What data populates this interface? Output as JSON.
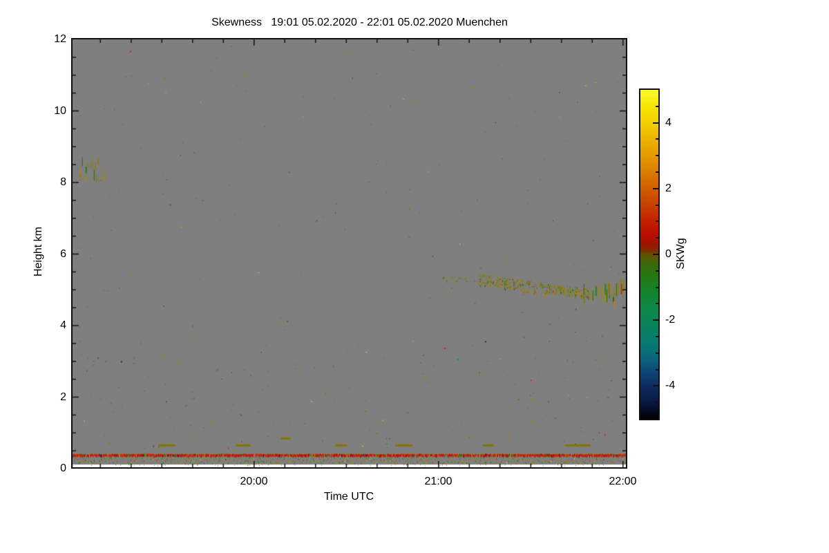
{
  "figure": {
    "title": "Skewness   19:01 05.02.2020 - 22:01 05.02.2020 Muenchen"
  },
  "axes": {
    "x": {
      "label": "Time UTC",
      "range_minutes": [
        0,
        180
      ],
      "start_time": "19:01",
      "end_time": "22:01",
      "major_ticks": [
        {
          "minutes": 59,
          "label": "20:00"
        },
        {
          "minutes": 119,
          "label": "21:00"
        },
        {
          "minutes": 179,
          "label": "22:00"
        }
      ],
      "minor_tick_minutes": 10
    },
    "y": {
      "label": "Height km",
      "range_km": [
        0,
        12
      ],
      "major_ticks": [
        {
          "km": 0,
          "label": "0"
        },
        {
          "km": 2,
          "label": "2"
        },
        {
          "km": 4,
          "label": "4"
        },
        {
          "km": 6,
          "label": "6"
        },
        {
          "km": 8,
          "label": "8"
        },
        {
          "km": 10,
          "label": "10"
        },
        {
          "km": 12,
          "label": "12"
        }
      ],
      "minor_tick_km": 0.5
    }
  },
  "colorbar": {
    "label": "SKWg",
    "range": [
      -5,
      5
    ],
    "major_ticks": [
      {
        "value": 4,
        "label": "4"
      },
      {
        "value": 2,
        "label": "2"
      },
      {
        "value": 0,
        "label": "0"
      },
      {
        "value": -2,
        "label": "-2"
      },
      {
        "value": -4,
        "label": "-4"
      }
    ],
    "minor_tick_step": 0.5,
    "gradient": [
      {
        "v": 5.0,
        "c": "#fcfc30"
      },
      {
        "v": 4.5,
        "c": "#f7e600"
      },
      {
        "v": 4.0,
        "c": "#f2cf00"
      },
      {
        "v": 3.5,
        "c": "#ecb500"
      },
      {
        "v": 3.0,
        "c": "#e49a00"
      },
      {
        "v": 2.5,
        "c": "#da7d00"
      },
      {
        "v": 2.0,
        "c": "#d05e00"
      },
      {
        "v": 1.5,
        "c": "#c74000"
      },
      {
        "v": 1.0,
        "c": "#c12000"
      },
      {
        "v": 0.6,
        "c": "#ba0d00"
      },
      {
        "v": 0.3,
        "c": "#9c1600"
      },
      {
        "v": 0.1,
        "c": "#7c2e00"
      },
      {
        "v": 0.0,
        "c": "#655000"
      },
      {
        "v": -0.3,
        "c": "#3a6a08"
      },
      {
        "v": -0.7,
        "c": "#237a14"
      },
      {
        "v": -1.2,
        "c": "#138531"
      },
      {
        "v": -1.7,
        "c": "#0d884a"
      },
      {
        "v": -2.2,
        "c": "#09825f"
      },
      {
        "v": -2.7,
        "c": "#077a70"
      },
      {
        "v": -3.2,
        "c": "#0a647c"
      },
      {
        "v": -3.6,
        "c": "#0d4473"
      },
      {
        "v": -4.0,
        "c": "#0e2c60"
      },
      {
        "v": -4.5,
        "c": "#091842"
      },
      {
        "v": -5.0,
        "c": "#000000"
      }
    ]
  },
  "style": {
    "page_bg": "#ffffff",
    "plot_bg": "#7f7f7f",
    "frame": "#101010",
    "no_data": "#ffffff"
  },
  "chart_data": {
    "type": "heatmap",
    "title": "Skewness",
    "subtitle": "19:01 05.02.2020 - 22:01 05.02.2020 Muenchen",
    "site": "Muenchen",
    "xlabel": "Time UTC",
    "ylabel": "Height km",
    "x_range_utc": [
      "19:01",
      "22:01"
    ],
    "y_range_km": [
      0,
      12
    ],
    "value_label": "SKWg",
    "value_range": [
      -5,
      5
    ],
    "background_meaning": "uniform grey = no signal / NaN skewness",
    "no_data_below_km": 0.12,
    "palettes": {
      "noise": [
        [
          "#8c7b00",
          40
        ],
        [
          "#a08c00",
          18
        ],
        [
          "#2e7d1e",
          14
        ],
        [
          "#256a10",
          6
        ],
        [
          "#cc7a00",
          8
        ],
        [
          "#c22800",
          6
        ],
        [
          "#ddd000",
          3
        ],
        [
          "#1d8c7a",
          2.5
        ],
        [
          "#1c2a6a",
          1.5
        ],
        [
          "#2a2a2a",
          2
        ]
      ],
      "virga": [
        [
          "#8c7b00",
          50
        ],
        [
          "#a08c00",
          22
        ],
        [
          "#256a10",
          10
        ],
        [
          "#2e7d1e",
          8
        ],
        [
          "#c22800",
          5
        ],
        [
          "#cc7a00",
          5
        ]
      ],
      "red_stripe": [
        [
          "#bc1c00",
          40
        ],
        [
          "#c92f00",
          25
        ],
        [
          "#a21300",
          15
        ],
        [
          "#d64000",
          8
        ],
        [
          "#2e7d1e",
          5
        ],
        [
          "#a09200",
          4
        ],
        [
          "#222222",
          3
        ]
      ],
      "surface": [
        [
          "#8c7b00",
          34
        ],
        [
          "#a08c00",
          22
        ],
        [
          "#2e7d1e",
          16
        ],
        [
          "#256a10",
          10
        ],
        [
          "#6b5e00",
          8
        ],
        [
          "#c22800",
          4
        ],
        [
          "#ddd000",
          3
        ],
        [
          "#cc7a00",
          3
        ]
      ]
    },
    "features": [
      {
        "kind": "scatter",
        "name": "background-speckle",
        "t": [
          0.5,
          179.5
        ],
        "h": [
          0.5,
          11.95
        ],
        "count": 400,
        "palette": "noise"
      },
      {
        "kind": "scatter",
        "name": "low-level-speckle",
        "t": [
          0.5,
          179.5
        ],
        "h": [
          0.5,
          3.6
        ],
        "count": 210,
        "palette": "noise"
      },
      {
        "kind": "streaks",
        "name": "aerosol-patch-8km",
        "t": [
          2,
          11.5
        ],
        "h": [
          7.85,
          8.5
        ],
        "count": 16,
        "len_km": [
          0.06,
          0.32
        ],
        "palette": "virga"
      },
      {
        "kind": "band",
        "name": "virga-onset",
        "t": [
          120,
          132
        ],
        "h_start": 5.33,
        "h_end": 5.28,
        "spread": 0.07,
        "count": 28,
        "palette": "virga"
      },
      {
        "kind": "band",
        "name": "virga-dense-1",
        "t": [
          132,
          154
        ],
        "h_start": 5.3,
        "h_end": 5.02,
        "spread": 0.17,
        "count": 300,
        "palette": "virga"
      },
      {
        "kind": "band",
        "name": "virga-dense-2",
        "t": [
          154,
          168
        ],
        "h_start": 5.05,
        "h_end": 4.9,
        "spread": 0.13,
        "count": 230,
        "palette": "virga"
      },
      {
        "kind": "streaks",
        "name": "virga-fallstreaks",
        "t": [
          166,
          179.5
        ],
        "h": [
          4.5,
          4.95
        ],
        "count": 26,
        "len_km": [
          0.08,
          0.38
        ],
        "palette": "virga"
      },
      {
        "kind": "dash",
        "name": "layer-dash-1",
        "t": [
          28.0,
          33.3
        ],
        "h": 0.68
      },
      {
        "kind": "dash",
        "name": "layer-dash-2",
        "t": [
          53.0,
          58.0
        ],
        "h": 0.68
      },
      {
        "kind": "dash",
        "name": "layer-dash-3",
        "t": [
          67.8,
          70.9
        ],
        "h": 0.87
      },
      {
        "kind": "dash",
        "name": "layer-dash-4",
        "t": [
          85.4,
          89.2
        ],
        "h": 0.68
      },
      {
        "kind": "dash",
        "name": "layer-dash-5",
        "t": [
          105.0,
          110.5
        ],
        "h": 0.68
      },
      {
        "kind": "dash",
        "name": "layer-dash-6",
        "t": [
          133.5,
          137.1
        ],
        "h": 0.68
      },
      {
        "kind": "dash",
        "name": "layer-dash-7",
        "t": [
          160.3,
          168.4
        ],
        "h": 0.68
      },
      {
        "kind": "red-stripe",
        "name": "near-surface-red-layer",
        "h": [
          0.34,
          0.42
        ]
      },
      {
        "kind": "surface-row",
        "name": "surface-speckle-layer",
        "h": [
          0.14,
          0.3
        ]
      }
    ],
    "dash_color": "#857400"
  }
}
